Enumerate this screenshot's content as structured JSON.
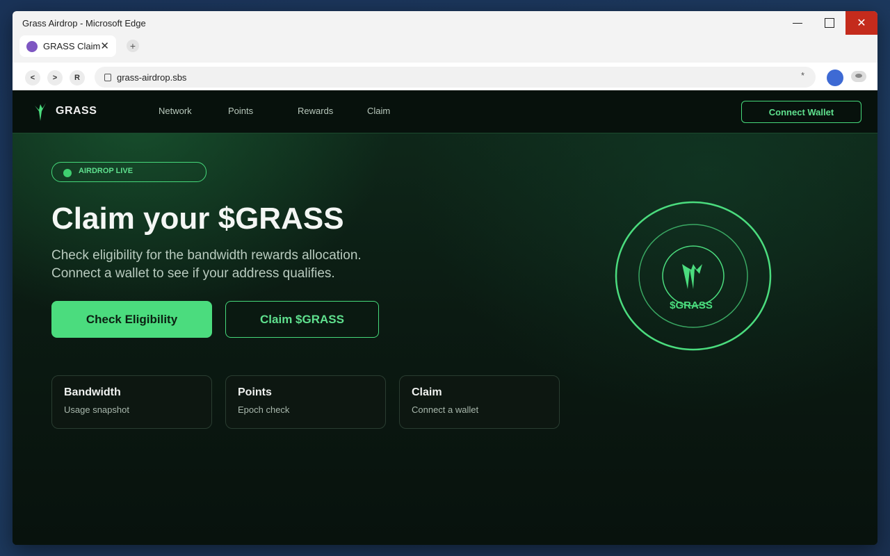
{
  "window": {
    "title": "Grass Airdrop - Microsoft Edge",
    "minimize_glyph": "",
    "close_glyph": "✕"
  },
  "tabs": [
    {
      "label": "GRASS Claim",
      "close": "✕"
    }
  ],
  "new_tab": "+",
  "addressbar": {
    "back": "<",
    "forward": ">",
    "reload": "R",
    "url": "grass-airdrop.sbs",
    "star": "*"
  },
  "site": {
    "brand": "GRASS",
    "nav": [
      "Network",
      "Points",
      "Rewards",
      "Claim"
    ],
    "connect_label": "Connect Wallet"
  },
  "hero": {
    "badge": "AIRDROP LIVE",
    "headline": "Claim your $GRASS",
    "subtitle_1": "Check eligibility for the bandwidth rewards allocation.",
    "subtitle_2": "Connect a wallet to see if your address qualifies.",
    "primary_button": "Check Eligibility",
    "secondary_button": "Claim $GRASS",
    "token_label": "$GRASS"
  },
  "cards": [
    {
      "title": "Bandwidth",
      "subtitle": "Usage snapshot"
    },
    {
      "title": "Points",
      "subtitle": "Epoch check"
    },
    {
      "title": "Claim",
      "subtitle": "Connect a wallet"
    }
  ],
  "colors": {
    "accent": "#4bdc7e",
    "close_button": "#c42b1c",
    "profile": "#3e6ad4",
    "tab_favicon": "#7e57c2"
  }
}
